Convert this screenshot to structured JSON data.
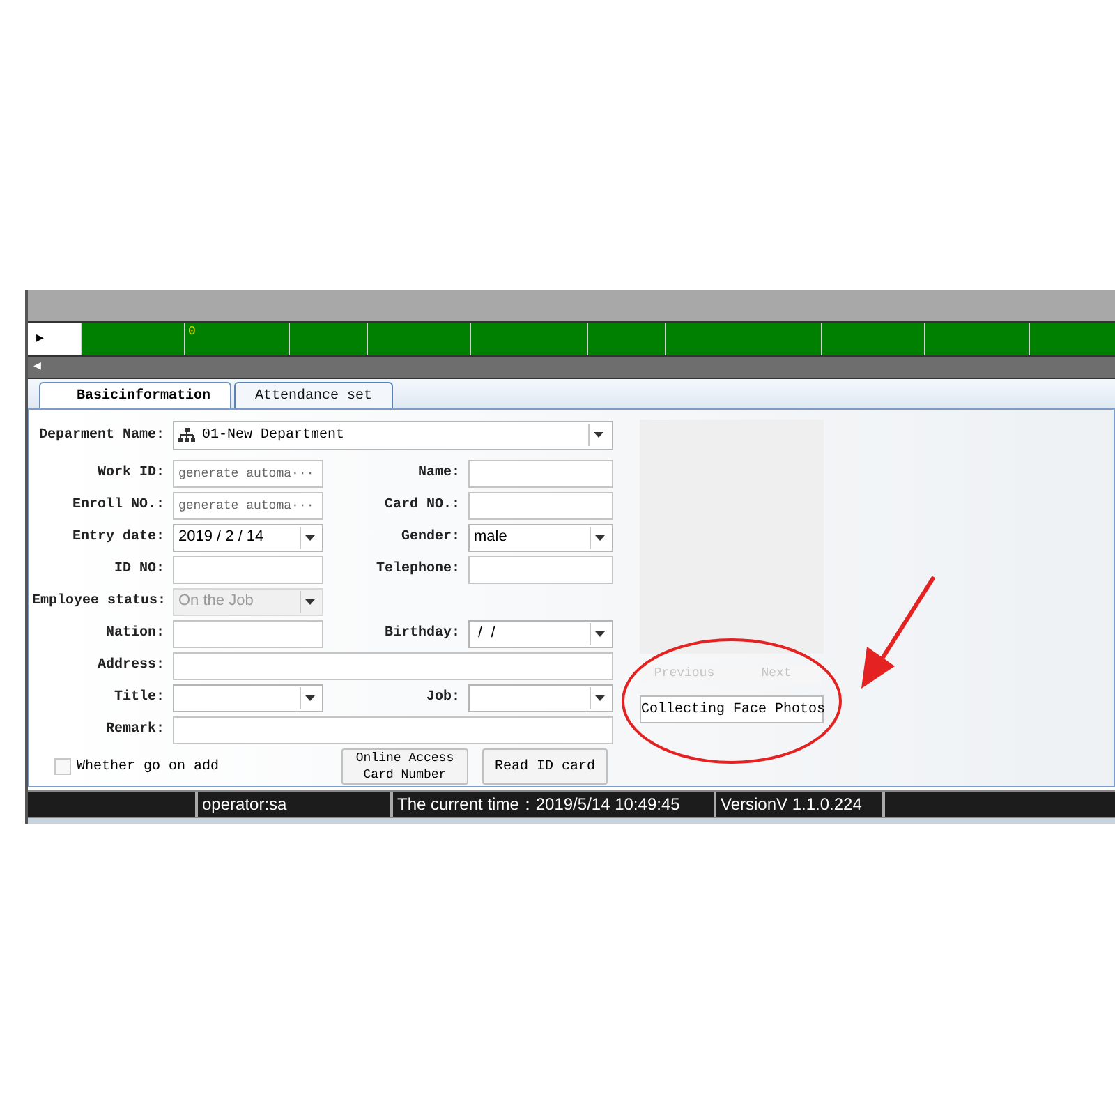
{
  "grid": {
    "row_marker": "▶",
    "cells": [
      "",
      "0",
      "",
      "",
      "",
      "",
      "",
      "",
      "",
      ""
    ]
  },
  "scrollbar": {
    "arrow": "◀"
  },
  "tabs": [
    {
      "label": "Basicinformation",
      "selected": true
    },
    {
      "label": "Attendance set",
      "selected": false
    }
  ],
  "department": {
    "label": "Deparment Name:",
    "value": "01-New Department"
  },
  "rows": [
    {
      "left": {
        "label": "Work ID:",
        "kind": "input",
        "placeholder": "generate automa···"
      },
      "right": {
        "label": "Name:",
        "kind": "input"
      }
    },
    {
      "left": {
        "label": "Enroll NO.:",
        "kind": "input",
        "placeholder": "generate automa···"
      },
      "right": {
        "label": "Card NO.:",
        "kind": "input"
      }
    },
    {
      "left": {
        "label": "Entry date:",
        "kind": "select",
        "value": "2019 / 2 / 14",
        "disabled": false
      },
      "right": {
        "label": "Gender:",
        "kind": "select",
        "value": "male",
        "disabled": false
      }
    },
    {
      "left": {
        "label": "ID NO:",
        "kind": "input"
      },
      "right": {
        "label": "Telephone:",
        "kind": "input"
      }
    },
    {
      "left": {
        "label": "Employee status:",
        "kind": "select",
        "value": "On the Job",
        "disabled": true
      }
    },
    {
      "left": {
        "label": "Nation:",
        "kind": "input"
      },
      "right": {
        "label": "Birthday:",
        "kind": "select",
        "value": " /  /",
        "disabled": false
      }
    },
    {
      "left": {
        "label": "Address:",
        "kind": "wide"
      }
    },
    {
      "left": {
        "label": "Title:",
        "kind": "select",
        "disabled": false
      },
      "right": {
        "label": "Job:",
        "kind": "select",
        "disabled": false
      }
    },
    {
      "left": {
        "label": "Remark:",
        "kind": "wide"
      }
    }
  ],
  "continue_add": {
    "label": "Whether go on add",
    "checked": false
  },
  "buttons": [
    "Online Access Card Number",
    "Read ID card"
  ],
  "photo": {
    "previous": "Previous",
    "next": "Next",
    "collect": "Collecting Face Photos"
  },
  "status_bar": [
    "operator:sa",
    "The current time：2019/5/14 10:49:45",
    "VersionV 1.1.0.224"
  ]
}
